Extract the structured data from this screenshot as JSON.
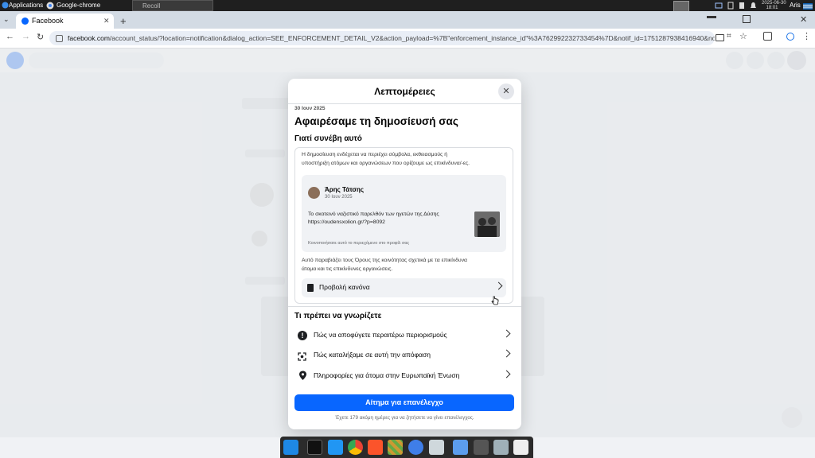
{
  "os_bar": {
    "applications_label": "Applications",
    "window1_label": "Google-chrome",
    "window2_label": "Recoll",
    "date": "2025-06-30",
    "time": "18:01",
    "user": "Aris"
  },
  "browser": {
    "tab_title": "Facebook",
    "new_tab_glyph": "+",
    "url_host": "facebook.com",
    "url_path": "/account_status/?location=notification&dialog_action=SEE_ENFORCEMENT_DETAIL_V2&action_payload=%7B\"enforcement_instance_id\"%3A762992232733454%7D&notif_id=1751287938416940&notif_t=ix_actor_noti..."
  },
  "modal": {
    "title": "Λεπτομέρειες",
    "date": "30 Ιουν 2025",
    "heading": "Αφαιρέσαμε τη δημοσίευσή σας",
    "why_heading": "Γιατί συνέβη αυτό",
    "why_text_1": "Η δημοσίευση ενδέχεται να περιέχει σύμβολα, εκθειασμούς ή",
    "why_text_2": "υποστήριξη ατόμων και οργανώσεων που ορίζουμε ως επικίνδυνα/-ες.",
    "post": {
      "author": "Άρης Τάτσης",
      "date": "30 Ιουν 2025",
      "text": "Το σκοτεινό ναζιστικό παρελθόν των ηγετών της Δύσης",
      "link": "https://oudensxolion.gr/?p=8092",
      "note": "Κοινοποιήσατε αυτό το περιεχόμενο στο προφίλ σας"
    },
    "rule_text_1": "Αυτό παραβιάζει τους Όρους της κοινότητας σχετικά με τα επικίνδυνα",
    "rule_text_2": "άτομα και τις επικίνδυνες οργανώσεις.",
    "view_rule_label": "Προβολή κανόνα",
    "know_heading": "Τι πρέπει να γνωρίζετε",
    "know_items": [
      {
        "label": "Πώς να αποφύγετε περαιτέρω περιορισμούς",
        "icon": "alert-icon"
      },
      {
        "label": "Πώς καταλήξαμε σε αυτή την απόφαση",
        "icon": "scan-face-icon"
      },
      {
        "label": "Πληροφορίες για άτομα στην Ευρωπαϊκή Ένωση",
        "icon": "location-pin-icon"
      }
    ],
    "appeal_button": "Αίτημα για επανέλεγχο",
    "footnote": "Έχετε 179 ακόμη ημέρες για να ζητήσετε να γίνει επανέλεγχος."
  },
  "colors": {
    "fb_blue": "#0866ff",
    "chrome_tabstrip": "#d3dbe4",
    "os_bar": "#1f1f1f"
  }
}
